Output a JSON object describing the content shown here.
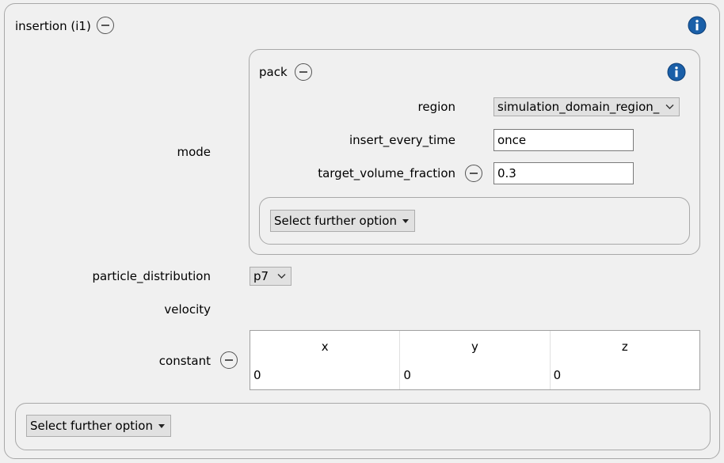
{
  "insertion": {
    "title": "insertion (i1)",
    "mode_label": "mode",
    "particle_distribution_label": "particle_distribution",
    "particle_distribution_value": "p7",
    "velocity_label": "velocity",
    "constant_label": "constant",
    "velocity_table": {
      "headers": [
        "x",
        "y",
        "z"
      ],
      "values": [
        "0",
        "0",
        "0"
      ]
    },
    "further_option_label": "Select further option"
  },
  "pack": {
    "title": "pack",
    "region_label": "region",
    "region_value": "simulation_domain_region_",
    "insert_every_time_label": "insert_every_time",
    "insert_every_time_value": "once",
    "target_volume_fraction_label": "target_volume_fraction",
    "target_volume_fraction_value": "0.3",
    "further_option_label": "Select further option"
  },
  "colors": {
    "info_icon": "#1a5fa8",
    "background": "#f0f0f0",
    "panel_border": "#a8a8a8"
  },
  "icons": {
    "info": "info-icon",
    "collapse": "minus-circle-icon",
    "dropdown": "chevron-down-icon"
  }
}
